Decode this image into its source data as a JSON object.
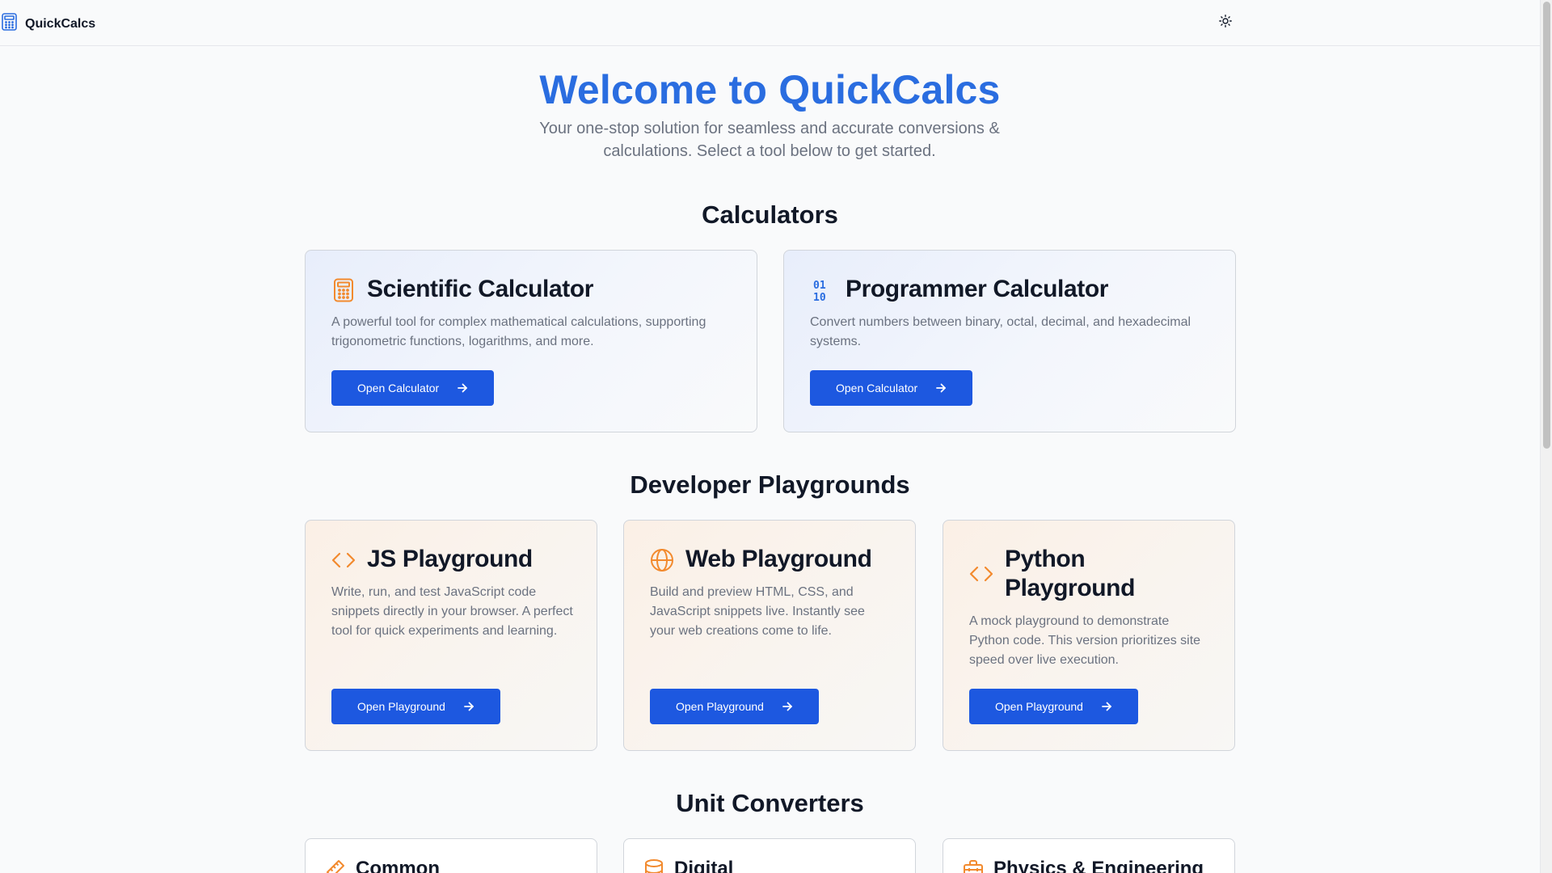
{
  "header": {
    "brand": "QuickCalcs",
    "theme_icon": "sun-icon"
  },
  "hero": {
    "title": "Welcome to QuickCalcs",
    "subtitle": "Your one-stop solution for seamless and accurate conversions & calculations. Select a tool below to get started."
  },
  "sections": {
    "calculators": "Calculators",
    "playgrounds": "Developer Playgrounds",
    "converters": "Unit Converters"
  },
  "calculators": [
    {
      "title": "Scientific Calculator",
      "description": "A powerful tool for complex mathematical calculations, supporting trigonometric functions, logarithms, and more.",
      "button": "Open Calculator",
      "icon": "calculator-icon"
    },
    {
      "title": "Programmer Calculator",
      "description": "Convert numbers between binary, octal, decimal, and hexadecimal systems.",
      "button": "Open Calculator",
      "icon": "binary-icon"
    }
  ],
  "playgrounds": [
    {
      "title": "JS Playground",
      "description": "Write, run, and test JavaScript code snippets directly in your browser. A perfect tool for quick experiments and learning.",
      "button": "Open Playground",
      "icon": "code-icon"
    },
    {
      "title": "Web Playground",
      "description": "Build and preview HTML, CSS, and JavaScript snippets live. Instantly see your web creations come to life.",
      "button": "Open Playground",
      "icon": "globe-icon"
    },
    {
      "title": "Python Playground",
      "description": "A mock playground to demonstrate Python code. This version prioritizes site speed over live execution.",
      "button": "Open Playground",
      "icon": "code-icon"
    }
  ],
  "converters": [
    {
      "title": "Common",
      "icon": "ruler-icon"
    },
    {
      "title": "Digital",
      "icon": "database-icon"
    },
    {
      "title": "Physics & Engineering",
      "icon": "toolbox-icon"
    }
  ],
  "colors": {
    "accent": "#2a6de0",
    "button": "#1d58e0",
    "icon_orange": "#f28a2e",
    "icon_blue": "#2a6de0"
  }
}
